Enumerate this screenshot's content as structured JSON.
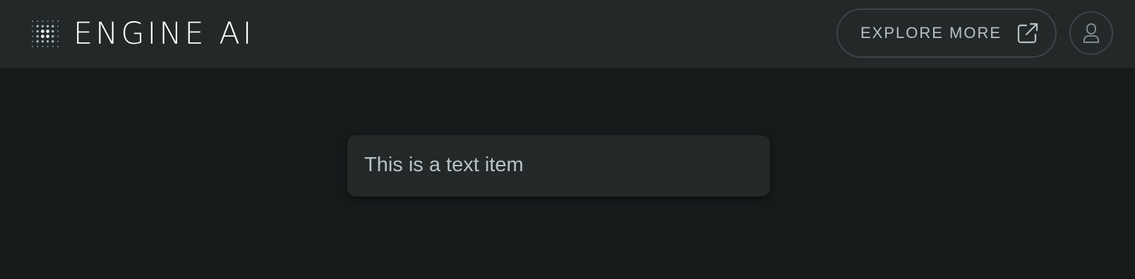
{
  "header": {
    "brand": "ENGINE AI",
    "explore_label": "EXPLORE MORE",
    "icons": {
      "logo": "dotted-grid-logo-icon",
      "explore": "external-link-icon",
      "user": "user-icon"
    }
  },
  "main": {
    "text_item": "This is a text item"
  },
  "colors": {
    "page_background": "#161a1b",
    "header_background": "#232829",
    "card_background": "#232829",
    "text": "#b8c2c2",
    "border": "#3d4546",
    "logo_text": "#ffffff"
  }
}
